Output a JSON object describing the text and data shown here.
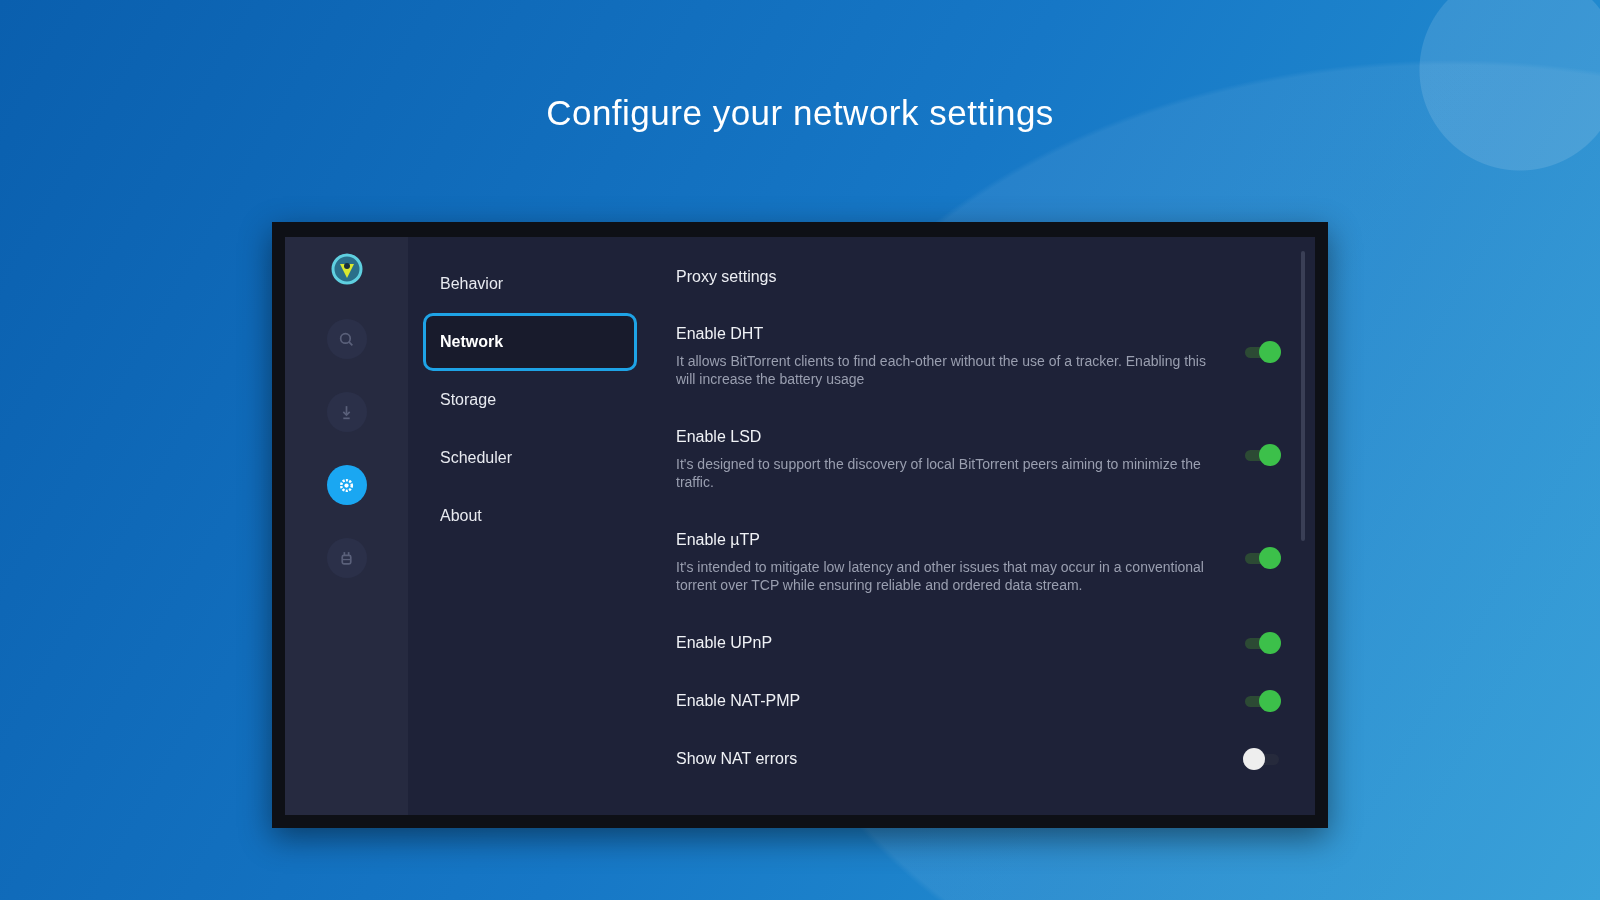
{
  "headline": "Configure your network settings",
  "rail": [
    {
      "kind": "search",
      "selected": false
    },
    {
      "kind": "download",
      "selected": false
    },
    {
      "kind": "settings",
      "selected": true
    },
    {
      "kind": "plug",
      "selected": false
    }
  ],
  "menu": [
    {
      "label": "Behavior",
      "selected": false
    },
    {
      "label": "Network",
      "selected": true
    },
    {
      "label": "Storage",
      "selected": false
    },
    {
      "label": "Scheduler",
      "selected": false
    },
    {
      "label": "About",
      "selected": false
    }
  ],
  "section_title": "Proxy settings",
  "settings": [
    {
      "title": "Enable DHT",
      "description": "It allows BitTorrent clients to find each-other without the use of a tracker. Enabling this will increase the battery usage",
      "on": true
    },
    {
      "title": "Enable LSD",
      "description": "It's designed to support the discovery of local BitTorrent peers aiming to minimize the traffic.",
      "on": true
    },
    {
      "title": "Enable µTP",
      "description": "It's intended to mitigate low latency and other issues that may occur in a conventional torrent over TCP while ensuring reliable and ordered data stream.",
      "on": true
    },
    {
      "title": "Enable UPnP",
      "on": true
    },
    {
      "title": "Enable NAT-PMP",
      "on": true
    },
    {
      "title": "Show NAT errors",
      "on": false
    }
  ]
}
